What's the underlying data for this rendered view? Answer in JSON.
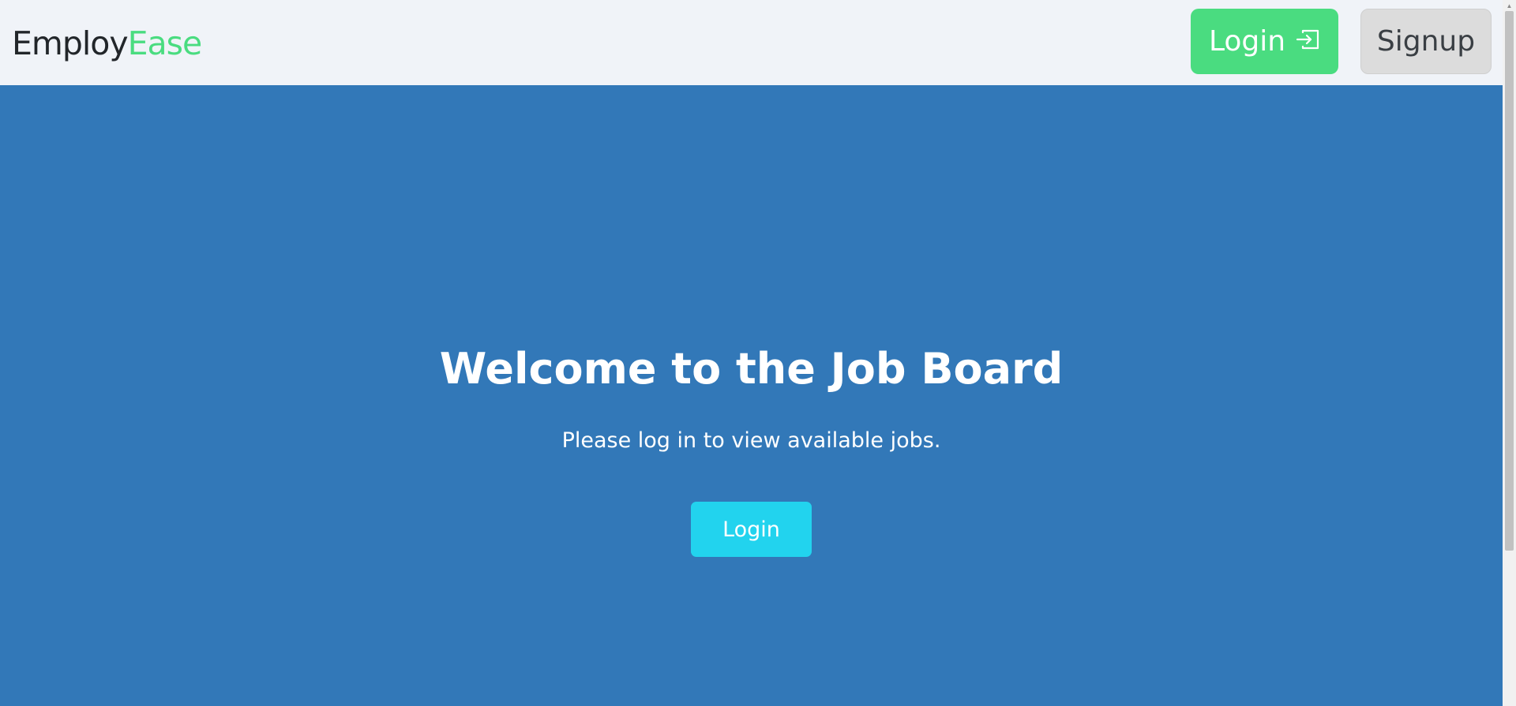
{
  "brand": {
    "part1": "Employ",
    "part2": "Ease"
  },
  "nav": {
    "login_label": "Login",
    "login_icon": "sign-in-icon",
    "signup_label": "Signup"
  },
  "hero": {
    "title": "Welcome to the Job Board",
    "subtitle": "Please log in to view available jobs.",
    "login_label": "Login"
  },
  "colors": {
    "navbar_bg": "#f0f3f8",
    "brand_dark": "#22262a",
    "brand_accent": "#4adc80",
    "login_nav_button": "#4adc80",
    "signup_button": "#dcdcdc",
    "hero_bg": "#3278b8",
    "hero_login_button": "#22d3ee"
  }
}
